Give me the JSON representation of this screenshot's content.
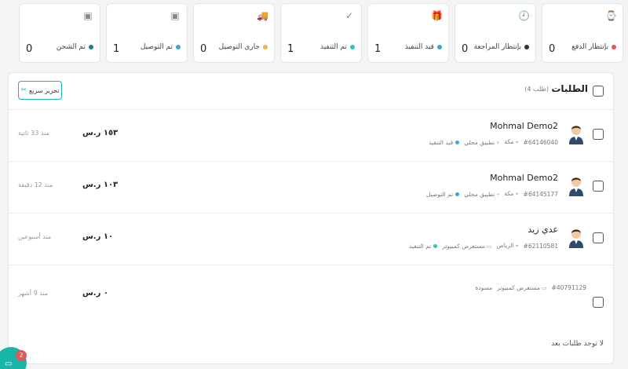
{
  "stats": [
    {
      "label": "بإنتظار الدفع",
      "value": "0",
      "icon": "watch-icon",
      "glyph": "⌚",
      "dot": "#e05757"
    },
    {
      "label": "بإنتظار المراجعة",
      "value": "0",
      "icon": "clock-icon",
      "glyph": "🕘",
      "dot": "#333333"
    },
    {
      "label": "قيد التنفيذ",
      "value": "1",
      "icon": "gift-icon",
      "glyph": "🎁",
      "dot": "#3da5d9"
    },
    {
      "label": "تم التنفيذ",
      "value": "1",
      "icon": "check-icon",
      "glyph": "✓",
      "dot": "#2ec4b6"
    },
    {
      "label": "جاري التوصيل",
      "value": "0",
      "icon": "truck-icon",
      "glyph": "🚚",
      "dot": "#e5b84a"
    },
    {
      "label": "تم التوصيل",
      "value": "1",
      "icon": "box-icon",
      "glyph": "▣",
      "dot": "#3da5d9"
    },
    {
      "label": "تم الشحن",
      "value": "0",
      "icon": "archive-icon",
      "glyph": "▣",
      "dot": "#1a7f8a"
    }
  ],
  "orders_header": {
    "title": "الطلبات",
    "count": "(4 طلب)",
    "quick_edit": "تحرير سريع",
    "quick_edit_icon": "✂"
  },
  "orders": [
    {
      "name": "Mohmal Demo2",
      "id": "#64146040",
      "city": "مكة",
      "source": "تطبيق محلي",
      "status": "قيد التنفيذ",
      "status_color": "#3da5d9",
      "amount": "١٥٣ ر.س",
      "time": "منذ 33 ثانية",
      "avatar": true
    },
    {
      "name": "Mohmal Demo2",
      "id": "#64145177",
      "city": "مكة",
      "source": "تطبيق محلي",
      "status": "تم التوصيل",
      "status_color": "#3da5d9",
      "amount": "١٠٣ ر.س",
      "time": "منذ 12 دقيقة",
      "avatar": true
    },
    {
      "name": "عدي زيد",
      "id": "#62110581",
      "city": "الرياض",
      "source": "مستعرض كمبيوتر",
      "status": "تم التنفيذ",
      "status_color": "#2ec4b6",
      "amount": "١٠ ر.س",
      "time": "منذ أسبوعين",
      "avatar": true
    },
    {
      "name": "",
      "id": "#40791129",
      "city": "",
      "source": "مستعرض كمبيوتر",
      "status": "مسودة",
      "status_color": "",
      "amount": "٠ ر.س",
      "time": "منذ 9 أشهر",
      "avatar": false
    }
  ],
  "empty_text": "لا توجد طلبات بعد",
  "chat": {
    "badge": "2",
    "icon": "chat-icon"
  },
  "colors": {
    "accent": "#19b5a8",
    "badge": "#e05757"
  }
}
